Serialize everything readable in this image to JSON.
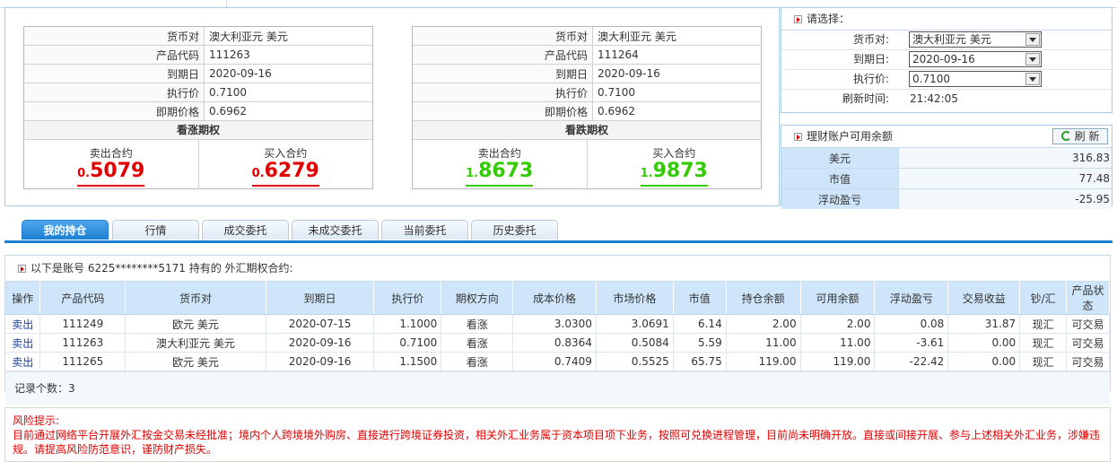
{
  "option_cards": [
    {
      "rows": [
        {
          "label": "货币对",
          "value": "澳大利亚元 美元"
        },
        {
          "label": "产品代码",
          "value": "111263"
        },
        {
          "label": "到期日",
          "value": "2020-09-16"
        },
        {
          "label": "执行价",
          "value": "0.7100"
        },
        {
          "label": "即期价格",
          "value": "0.6962"
        }
      ],
      "title": "看涨期权",
      "sell": {
        "label": "卖出合约",
        "small": "0.",
        "big": "5079"
      },
      "buy": {
        "label": "买入合约",
        "small": "0.",
        "big": "6279"
      }
    },
    {
      "rows": [
        {
          "label": "货币对",
          "value": "澳大利亚元 美元"
        },
        {
          "label": "产品代码",
          "value": "111264"
        },
        {
          "label": "到期日",
          "value": "2020-09-16"
        },
        {
          "label": "执行价",
          "value": "0.7100"
        },
        {
          "label": "即期价格",
          "value": "0.6962"
        }
      ],
      "title": "看跌期权",
      "sell": {
        "label": "卖出合约",
        "small": "1.",
        "big": "8673"
      },
      "buy": {
        "label": "买入合约",
        "small": "1.",
        "big": "9873"
      }
    }
  ],
  "select_panel": {
    "title": "请选择：",
    "fields": [
      {
        "label": "货币对:",
        "value": "澳大利亚元 美元"
      },
      {
        "label": "到期日:",
        "value": "2020-09-16"
      },
      {
        "label": "执行价:",
        "value": "0.7100"
      }
    ],
    "refresh_label": "刷新时间:",
    "refresh_time": "21:42:05"
  },
  "balance_panel": {
    "title": "理财账户可用余额",
    "refresh_button": "刷 新",
    "rows": [
      {
        "label": "美元",
        "value": "316.83"
      },
      {
        "label": "市值",
        "value": "77.48"
      },
      {
        "label": "浮动盈亏",
        "value": "-25.95"
      }
    ]
  },
  "tabs": [
    "我的持仓",
    "行情",
    "成交委托",
    "未成交委托",
    "当前委托",
    "历史委托"
  ],
  "holdings": {
    "header": "以下是账号 6225********5171 持有的 外汇期权合约:",
    "columns": [
      "操作",
      "产品代码",
      "货币对",
      "到期日",
      "执行价",
      "期权方向",
      "成本价格",
      "市场价格",
      "市值",
      "持仓余额",
      "可用余额",
      "浮动盈亏",
      "交易收益",
      "钞/汇",
      "产品状态"
    ],
    "rows": [
      [
        "卖出",
        "111249",
        "欧元 美元",
        "2020-07-15",
        "1.1000",
        "看涨",
        "3.0300",
        "3.0691",
        "6.14",
        "2.00",
        "2.00",
        "0.08",
        "31.87",
        "现汇",
        "可交易"
      ],
      [
        "卖出",
        "111263",
        "澳大利亚元 美元",
        "2020-09-16",
        "0.7100",
        "看涨",
        "0.8364",
        "0.5084",
        "5.59",
        "11.00",
        "11.00",
        "-3.61",
        "0.00",
        "现汇",
        "可交易"
      ],
      [
        "卖出",
        "111265",
        "欧元 美元",
        "2020-09-16",
        "1.1500",
        "看涨",
        "0.7409",
        "0.5525",
        "65.75",
        "119.00",
        "119.00",
        "-22.42",
        "0.00",
        "现汇",
        "可交易"
      ]
    ],
    "record_count_label": "记录个数：",
    "record_count": "3"
  },
  "risk": {
    "title": "风险提示:",
    "text": "目前通过网络平台开展外汇按金交易未经批准；境内个人跨境境外购房、直接进行跨境证券投资，相关外汇业务属于资本项目项下业务，按照可兑换进程管理，目前尚未明确开放。直接或间接开展、参与上述相关外汇业务，涉嫌违规。请提高风险防范意识，谨防财产损失。"
  },
  "colors": {
    "accent": "#1c7fd3",
    "call_price": "#e00000",
    "put_price": "#33cc00",
    "header_bg": "#cfe6fa"
  }
}
